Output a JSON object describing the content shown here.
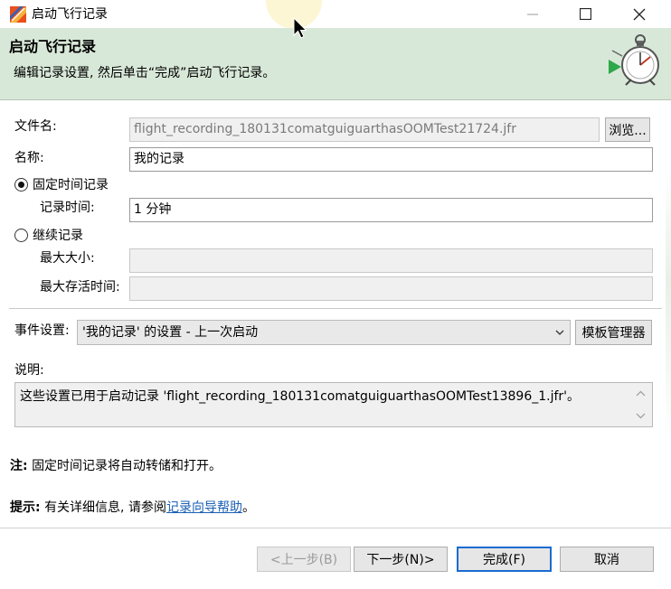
{
  "window": {
    "title": "启动飞行记录",
    "icon": "flight-recorder-app-icon",
    "controls": {
      "minimize": "minimize-icon",
      "maximize": "maximize-icon",
      "close": "close-icon"
    }
  },
  "banner": {
    "title": "启动飞行记录",
    "description": "编辑记录设置, 然后单击“完成”启动飞行记录。",
    "graphic": "stopwatch-icon",
    "background": "#d8e8d8"
  },
  "form": {
    "filename": {
      "label": "文件名:",
      "value": "flight_recording_180131comatguiguarthasOOMTest21724.jfr",
      "browse_label": "浏览..."
    },
    "name": {
      "label": "名称:",
      "value": "我的记录"
    },
    "fixed_time": {
      "label": "固定时间记录",
      "selected": true
    },
    "record_time": {
      "label": "记录时间:",
      "value": "1 分钟"
    },
    "continuous": {
      "label": "继续记录",
      "selected": false
    },
    "max_size": {
      "label": "最大大小:",
      "value": ""
    },
    "max_age": {
      "label": "最大存活时间:",
      "value": ""
    },
    "event_settings": {
      "label": "事件设置:",
      "selected": "'我的记录' 的设置 - 上一次启动",
      "template_button": "模板管理器"
    },
    "description": {
      "label": "说明:",
      "text": "这些设置已用于启动记录 'flight_recording_180131comatguiguarthasOOMTest13896_1.jfr'。"
    }
  },
  "notes": {
    "note_prefix": "注:",
    "note_text": "固定时间记录将自动转储和打开。",
    "hint_prefix": "提示:",
    "hint_text": "有关详细信息, 请参阅",
    "hint_link": "记录向导帮助",
    "hint_suffix": "。"
  },
  "footer": {
    "back": "<上一步(B)",
    "next": "下一步(N)>",
    "finish": "完成(F)",
    "cancel": "取消"
  },
  "colors": {
    "accent": "#1a6bd0",
    "link": "#1a5fb4"
  }
}
